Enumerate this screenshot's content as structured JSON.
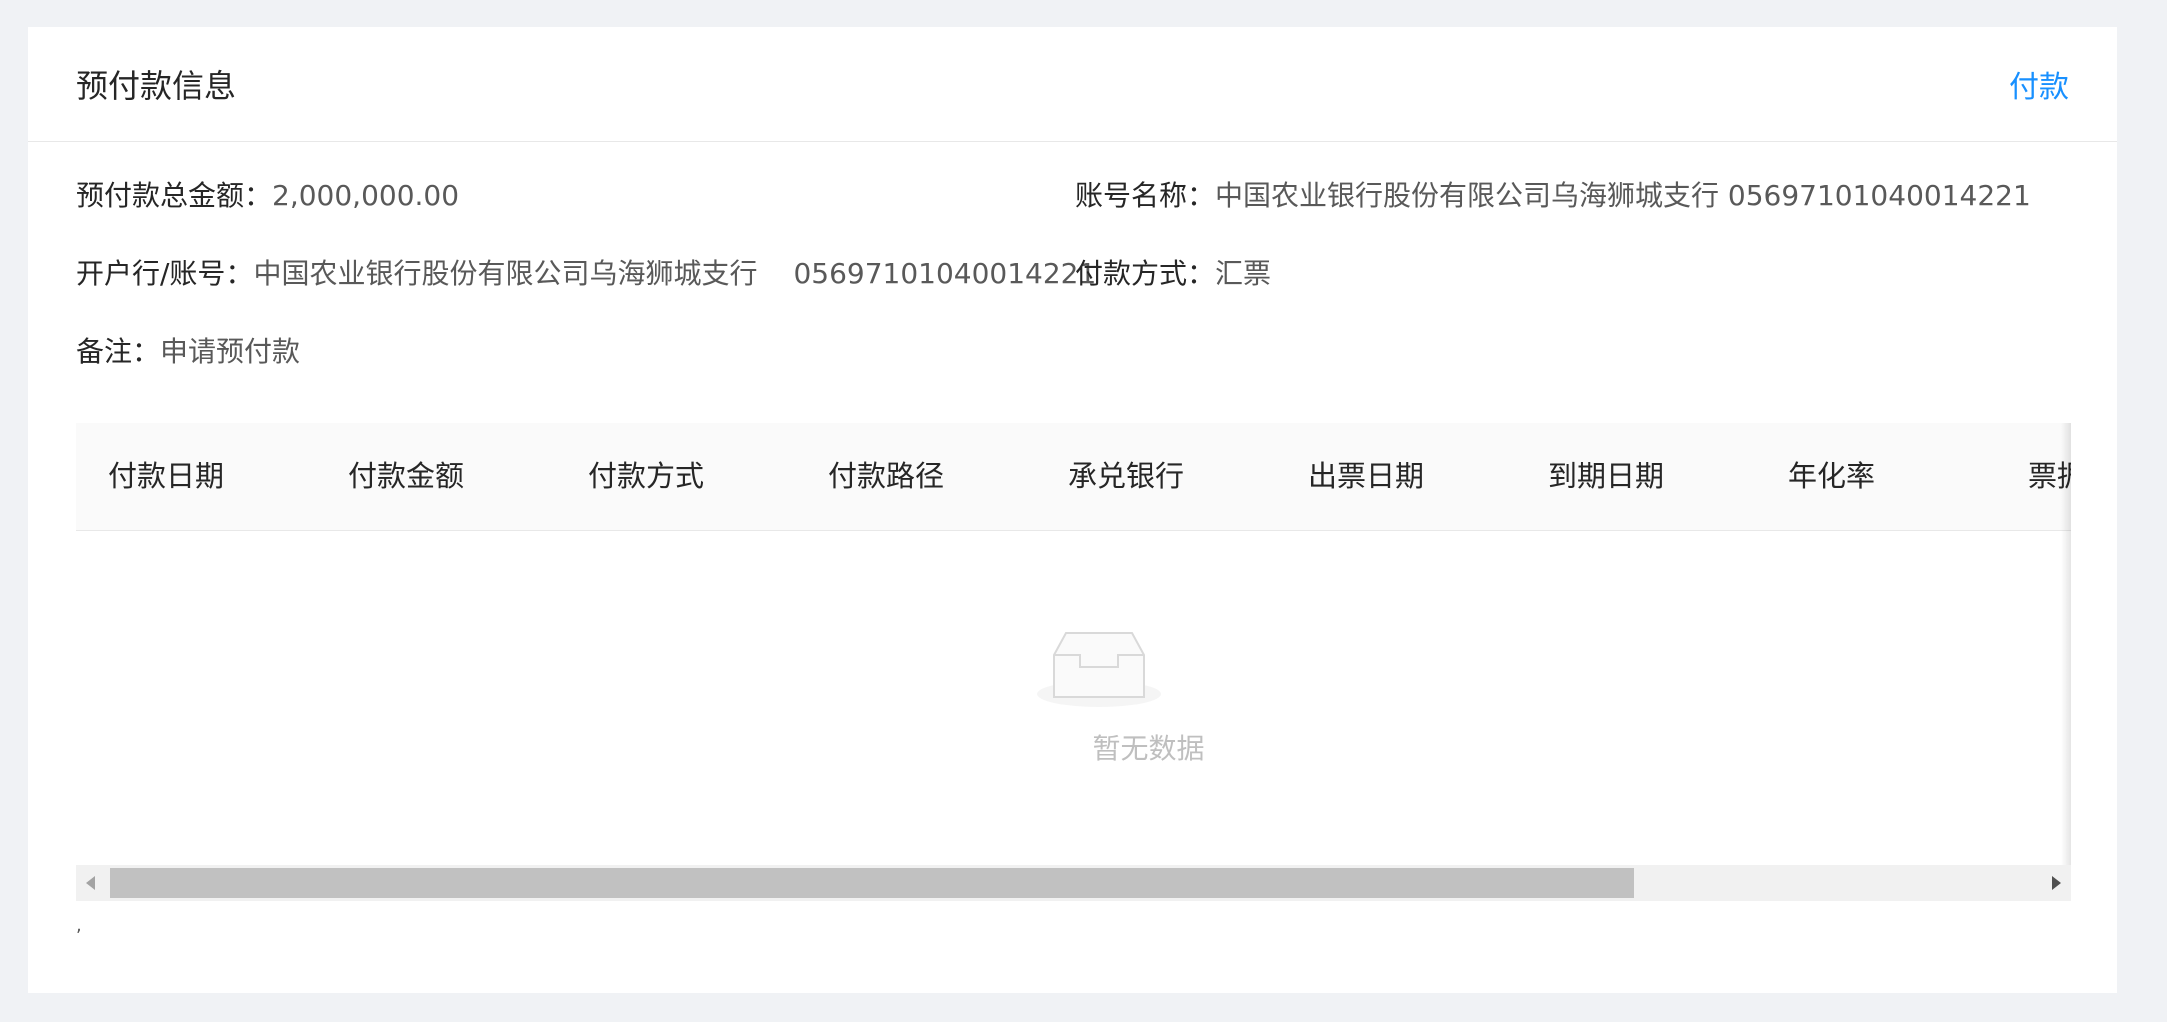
{
  "card": {
    "title": "预付款信息",
    "pay_link": "付款"
  },
  "details": {
    "total_amount": {
      "label": "预付款总金额：",
      "value": "2,000,000.00"
    },
    "account_name": {
      "label": "账号名称：",
      "value": "中国农业银行股份有限公司乌海狮城支行 05697101040014221"
    },
    "bank_account": {
      "label": "开户行/账号：",
      "bank": "中国农业银行股份有限公司乌海狮城支行",
      "account": "05697101040014221"
    },
    "payment_method": {
      "label": "付款方式：",
      "value": "汇票"
    },
    "remark": {
      "label": "备注：",
      "value": "申请预付款"
    }
  },
  "table": {
    "columns": [
      "付款日期",
      "付款金额",
      "付款方式",
      "付款路径",
      "承兑银行",
      "出票日期",
      "到期日期",
      "年化率",
      "票据"
    ],
    "rows": [],
    "empty_text": "暂无数据"
  },
  "footer": {
    "stray_mark": ","
  },
  "colors": {
    "page_bg": "#f0f2f5",
    "accent": "#1890ff",
    "table_header_bg": "#fafafa",
    "border": "#e8e8e8",
    "muted_text": "#bfbfbf"
  },
  "icons": {
    "empty_state": "empty-inbox-icon",
    "scroll_left": "triangle-left-icon",
    "scroll_right": "triangle-right-icon"
  }
}
